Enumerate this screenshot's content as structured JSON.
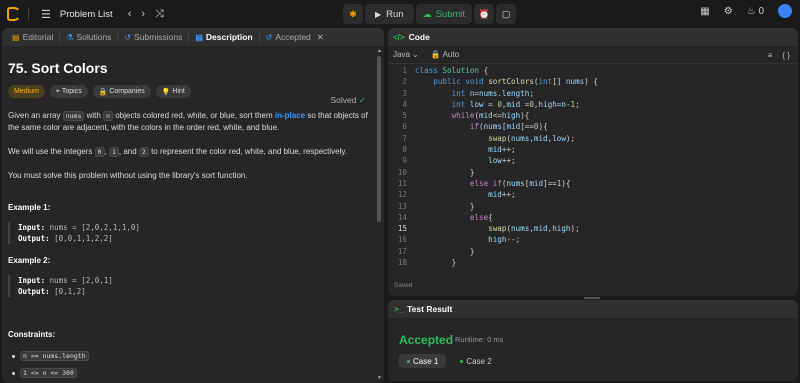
{
  "topbar": {
    "problem_list": "Problem List",
    "run": "Run",
    "submit": "Submit",
    "streak": "0"
  },
  "tabs": [
    {
      "label": "Editorial"
    },
    {
      "label": "Solutions"
    },
    {
      "label": "Submissions"
    },
    {
      "label": "Description"
    },
    {
      "label": "Accepted"
    }
  ],
  "problem": {
    "title": "75. Sort Colors",
    "status": "Solved",
    "difficulty": "Medium",
    "chips": [
      "Topics",
      "Companies",
      "Hint"
    ],
    "desc1_a": "Given an array",
    "desc1_code1": "nums",
    "desc1_b": "with",
    "desc1_code2": "n",
    "desc1_c": "objects colored red, white, or blue, sort them",
    "desc1_link": "in-place",
    "desc1_d": "so that objects of the same color are adjacent, with the colors in the order red, white, and blue.",
    "desc2_a": "We will use the integers",
    "desc2_c0": "0",
    "desc2_c1": "1",
    "desc2_b": ", and",
    "desc2_c2": "2",
    "desc2_d": "to represent the color red, white, and blue, respectively.",
    "desc3": "You must solve this problem without using the library's sort function.",
    "example1_title": "Example 1:",
    "example1_input_label": "Input:",
    "example1_input": "nums = [2,0,2,1,1,0]",
    "example1_output_label": "Output:",
    "example1_output": "[0,0,1,1,2,2]",
    "example2_title": "Example 2:",
    "example2_input_label": "Input:",
    "example2_input": "nums = [2,0,1]",
    "example2_output_label": "Output:",
    "example2_output": "[0,1,2]",
    "constraints_title": "Constraints:",
    "constraints": [
      "n == nums.length",
      "1 <= n <= 300"
    ]
  },
  "code": {
    "header": "Code",
    "language": "Java",
    "mode": "Auto",
    "saved": "Saved",
    "current_line": 15
  },
  "result": {
    "header": "Test Result",
    "status": "Accepted",
    "runtime": "Runtime: 0 ms",
    "cases": [
      "Case 1",
      "Case 2"
    ]
  },
  "colors": {
    "accent_green": "#2cbb5d",
    "medium": "#ffb800",
    "link_blue": "#3a9bff"
  }
}
